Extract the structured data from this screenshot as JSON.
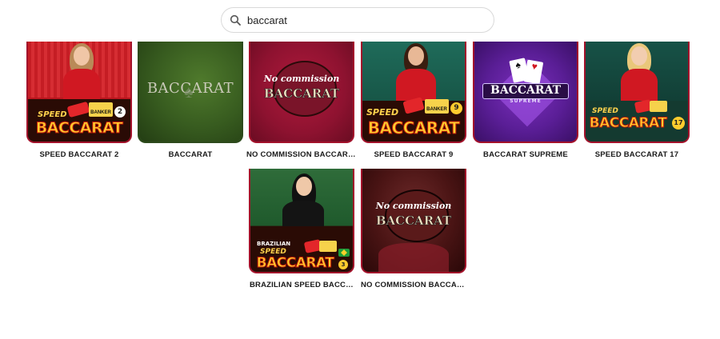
{
  "search": {
    "value": "baccarat",
    "placeholder": ""
  },
  "games": [
    {
      "title": "SPEED BACCARAT 2"
    },
    {
      "title": "BACCARAT"
    },
    {
      "title": "NO COMMISSION BACCARA..."
    },
    {
      "title": "SPEED BACCARAT 9"
    },
    {
      "title": "BACCARAT SUPREME"
    },
    {
      "title": "SPEED BACCARAT 17"
    },
    {
      "title": "BRAZILIAN SPEED BACCARA..."
    },
    {
      "title": "NO COMMISSION BACCARA..."
    }
  ],
  "tile_art": {
    "speed_word": "SPEED",
    "baccarat_word": "BACCARAT",
    "banker_word": "BANKER",
    "player_word": "PLAYER",
    "no_commission_words": "No commission",
    "supreme_word": "SUPREME",
    "brazilian_word": "BRAZILIAN",
    "tile1_number": "2",
    "tile4_number": "9",
    "tile6_number": "17",
    "tile7_number": "3"
  },
  "colors": {
    "accent_red": "#a3122b",
    "gold": "#ffcc2e"
  },
  "icons": {
    "search": "search-icon",
    "flag": "brazil-flag-icon"
  }
}
